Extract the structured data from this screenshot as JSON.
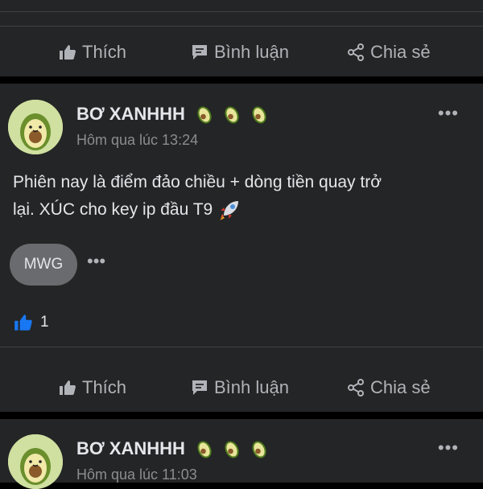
{
  "actions": {
    "like_label": "Thích",
    "comment_label": "Bình luận",
    "share_label": "Chia sẻ"
  },
  "posts": [
    {
      "author": "BƠ XANHHH",
      "time": "Hôm qua lúc 13:24",
      "text_line1": "Phiên nay là điểm đảo chiều + dòng tiền quay trở",
      "text_line2": "lại. XÚC cho key ip đầu T9",
      "tag": "MWG",
      "tag_more": "•••",
      "like_count": "1",
      "more": "•••"
    },
    {
      "author": "BƠ XANHHH",
      "time": "Hôm qua lúc 11:03",
      "more": "•••"
    }
  ],
  "icons": {
    "like": "thumbs-up-icon",
    "comment": "comment-icon",
    "share": "share-icon",
    "reaction": "like-reaction-icon",
    "avatar": "avocado-avatar",
    "emoji": "avocado-emoji",
    "post_emoji": "rocket-emoji"
  },
  "colors": {
    "background": "#000000",
    "card": "#242526",
    "text": "#e4e6eb",
    "muted": "#8a8d91",
    "like_blue": "#1877f2",
    "pill": "#6a6b6e"
  }
}
